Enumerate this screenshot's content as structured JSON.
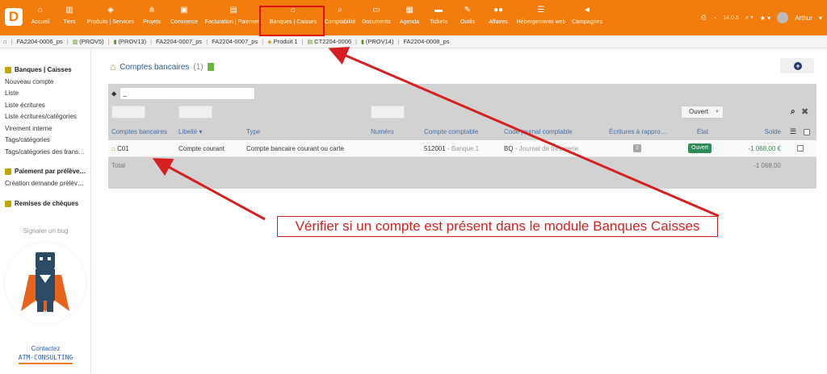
{
  "app": {
    "logo_letter": "D",
    "brand_color": "#f27c0c"
  },
  "topmenu": [
    {
      "label": "Accueil",
      "icon": "home-icon",
      "glyph": "⌂"
    },
    {
      "label": "Tiers",
      "icon": "building-icon",
      "glyph": "▥"
    },
    {
      "label": "Produits | Services",
      "icon": "cube-icon",
      "glyph": "◈"
    },
    {
      "label": "Projets",
      "icon": "sitemap-icon",
      "glyph": "⋔"
    },
    {
      "label": "Commerce",
      "icon": "briefcase-icon",
      "glyph": "▣"
    },
    {
      "label": "Facturation | Paiement",
      "icon": "invoice-icon",
      "glyph": "▤"
    },
    {
      "label": "Banques | Caisses",
      "icon": "bank-icon",
      "glyph": "⌂"
    },
    {
      "label": "Comptabilité",
      "icon": "search-dollar-icon",
      "glyph": "⌕"
    },
    {
      "label": "Documents",
      "icon": "folder-icon",
      "glyph": "▭"
    },
    {
      "label": "Agenda",
      "icon": "calendar-icon",
      "glyph": "▦"
    },
    {
      "label": "Tickets",
      "icon": "ticket-icon",
      "glyph": "▬"
    },
    {
      "label": "Outils",
      "icon": "wrench-icon",
      "glyph": "✎"
    },
    {
      "label": "Affaires",
      "icon": "affaires-icon",
      "glyph": "●●"
    },
    {
      "label": "Hébergements web",
      "icon": "server-icon",
      "glyph": "☰"
    },
    {
      "label": "Campagnes",
      "icon": "bullhorn-icon",
      "glyph": "◄"
    }
  ],
  "toolbar": {
    "version": "14.0.5",
    "user": "Arthur"
  },
  "breadcrumbs": [
    {
      "label": "FA2204-0006_ps",
      "icon": "none"
    },
    {
      "label": "(PROV5)",
      "icon": "company-icon"
    },
    {
      "label": "(PROV13)",
      "icon": "doc-icon"
    },
    {
      "label": "FA2204-0007_ps",
      "icon": "none"
    },
    {
      "label": "FA2204-0007_ps",
      "icon": "none"
    },
    {
      "label": "Produit 1",
      "icon": "cube-icon"
    },
    {
      "label": "CT2204-0006",
      "icon": "contract-icon"
    },
    {
      "label": "(PROV14)",
      "icon": "doc-icon"
    },
    {
      "label": "FA2204-0008_ps",
      "icon": "none"
    }
  ],
  "sidebar": {
    "section1": "Banques | Caisses",
    "links1": [
      "Nouveau compte",
      "Liste",
      "Liste écritures",
      "Liste écritures/catégories",
      "Virement interne",
      "Tags/catégories",
      "Tags/catégories des trans…"
    ],
    "section2": "Paiement par prélève…",
    "links2": [
      "Création demande prélèv…"
    ],
    "section3": "Remises de chèques",
    "bug": "Signaler un bug",
    "contact1": "Contactez",
    "contact2": "ATM-CONSULTING"
  },
  "main": {
    "title": "Comptes bancaires",
    "count": "(1)",
    "tag_placeholder": "_",
    "status_filter": "Ouvert",
    "headers": {
      "account": "Comptes bancaires",
      "label": "Libellé",
      "type": "Type",
      "number": "Numéro",
      "accounting": "Compte comptable",
      "journal": "Code journal comptable",
      "reconcile": "Écritures à rappro…",
      "state": "État",
      "balance": "Solde"
    },
    "row": {
      "ref": "C01",
      "label": "Compte courant",
      "type": "Compte bancaire courant ou carte",
      "account_code": "512001",
      "account_sep": " - ",
      "account_name": "Banque 1",
      "journal_code": "BQ",
      "journal_sep": " - ",
      "journal_name": "Journal de trésorerie",
      "reconcile": "2",
      "state": "Ouvert",
      "balance": "-1 068,00 €"
    },
    "total_label": "Total",
    "total_value": "-1 068,00"
  },
  "annotation": {
    "callout": "Vérifier si un compte est présent dans le module Banques Caisses",
    "color": "#d62020"
  }
}
